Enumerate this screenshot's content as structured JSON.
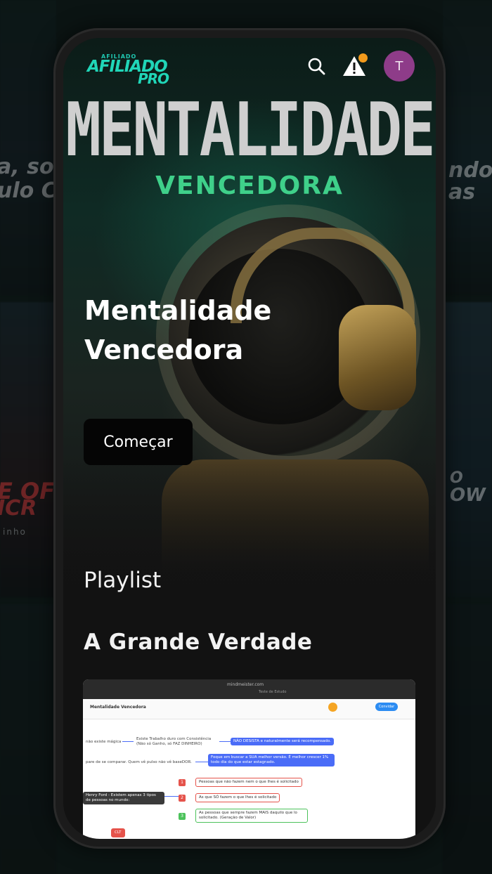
{
  "background": {
    "left_text_1": "a, so",
    "left_text_2": "ulo C",
    "left_text_3": "E OF",
    "left_text_4": "ICR",
    "left_caption": "inho",
    "right_text_1": "ndo",
    "right_text_2": "as",
    "right_text_3": "O",
    "right_text_4": "OW"
  },
  "header": {
    "logo_top": "AFILIADO",
    "logo_main": "AFILIADO",
    "logo_sub": "PRO",
    "search_icon": "search-icon",
    "alert_icon": "warning-icon",
    "avatar_initial": "T",
    "colors": {
      "accent": "#20d6b8",
      "notification": "#f29a1c",
      "avatar": "#8e3c89"
    }
  },
  "hero": {
    "banner_title": "MENTALIDADE",
    "banner_subtitle": "VENCEDORA",
    "title": "Mentalidade Vencedora",
    "start_button": "Começar"
  },
  "playlist": {
    "label": "Playlist",
    "section_title": "A Grande Verdade",
    "thumbnail": {
      "url": "mindmeister.com",
      "tabs": "Teste de Estudo",
      "board_name": "Mentalidade Vencedora",
      "share_button": "Convidar",
      "nodes": [
        "não existe mágica",
        "Existe Trabalho duro com Consistência (Não só Ganho, só FAZ DINHEIRO)",
        "NÃO DESISTA e naturalmente será recompensado.",
        "pare de se comparar. Quem vê pulso não vê baseDOR.",
        "Foque em buscar a SUA melhor versão. É melhor crescer 1% todo dia do que estar estagnado.",
        "Henry Ford - Existem apenas 3 tipos de pessoas no mundo:",
        "Pessoas que não fazem nem o que lhes é solicitado",
        "As que SÓ fazem o que lhes é solicitado",
        "As pessoas que sempre fazem MAIS daquilo que lo solicitado. (Geração de Valor)",
        "CLT"
      ],
      "badges": [
        "1",
        "2",
        "3"
      ]
    }
  }
}
